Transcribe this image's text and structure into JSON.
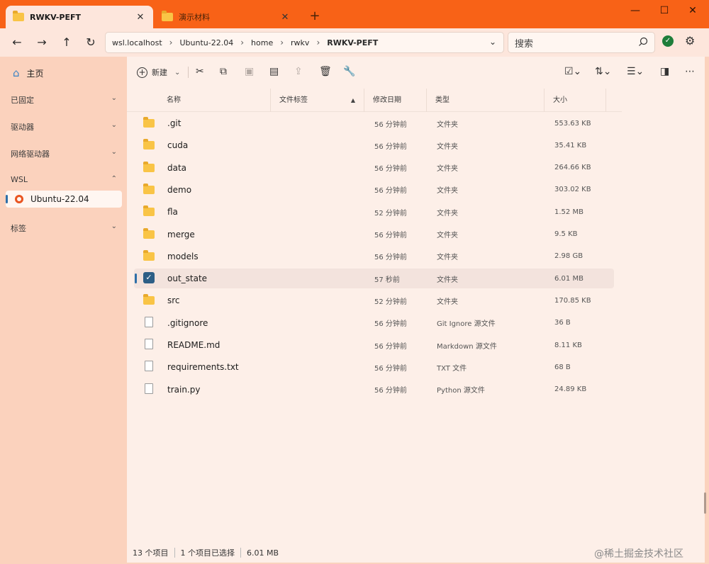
{
  "tabs": [
    {
      "label": "RWKV-PEFT",
      "close": "✕"
    },
    {
      "label": "演示材料",
      "close": "✕"
    }
  ],
  "new_tab": "+",
  "window_controls": {
    "minimize": "—",
    "maximize": "☐",
    "close": "✕"
  },
  "nav": {
    "back": "←",
    "forward": "→",
    "up": "↑",
    "refresh": "↻"
  },
  "breadcrumb": [
    "wsl.localhost",
    "Ubuntu-22.04",
    "home",
    "rwkv",
    "RWKV-PEFT"
  ],
  "breadcrumb_sep": "›",
  "search": {
    "placeholder": "搜索"
  },
  "sidebar": {
    "home": "主页",
    "sections": [
      {
        "label": "已固定",
        "chevron": "⌄"
      },
      {
        "label": "驱动器",
        "chevron": "⌄"
      },
      {
        "label": "网络驱动器",
        "chevron": "⌄"
      },
      {
        "label": "WSL",
        "chevron": "⌃"
      },
      {
        "label": "标签",
        "chevron": "⌄"
      }
    ],
    "selected_item": "Ubuntu-22.04"
  },
  "toolbar": {
    "new_label": "新建",
    "more": "⋯"
  },
  "columns": [
    "名称",
    "文件标签",
    "修改日期",
    "类型",
    "大小"
  ],
  "sort_indicator": "▲",
  "files": [
    {
      "name": ".git",
      "date": "56 分钟前",
      "type": "文件夹",
      "size": "553.63 KB",
      "kind": "folder"
    },
    {
      "name": "cuda",
      "date": "56 分钟前",
      "type": "文件夹",
      "size": "35.41 KB",
      "kind": "folder"
    },
    {
      "name": "data",
      "date": "56 分钟前",
      "type": "文件夹",
      "size": "264.66 KB",
      "kind": "folder"
    },
    {
      "name": "demo",
      "date": "56 分钟前",
      "type": "文件夹",
      "size": "303.02 KB",
      "kind": "folder"
    },
    {
      "name": "fla",
      "date": "52 分钟前",
      "type": "文件夹",
      "size": "1.52 MB",
      "kind": "folder"
    },
    {
      "name": "merge",
      "date": "56 分钟前",
      "type": "文件夹",
      "size": "9.5 KB",
      "kind": "folder"
    },
    {
      "name": "models",
      "date": "56 分钟前",
      "type": "文件夹",
      "size": "2.98 GB",
      "kind": "folder"
    },
    {
      "name": "out_state",
      "date": "57 秒前",
      "type": "文件夹",
      "size": "6.01 MB",
      "kind": "selected"
    },
    {
      "name": "src",
      "date": "52 分钟前",
      "type": "文件夹",
      "size": "170.85 KB",
      "kind": "folder"
    },
    {
      "name": ".gitignore",
      "date": "56 分钟前",
      "type": "Git Ignore 源文件",
      "size": "36 B",
      "kind": "file"
    },
    {
      "name": "README.md",
      "date": "56 分钟前",
      "type": "Markdown 源文件",
      "size": "8.11 KB",
      "kind": "file"
    },
    {
      "name": "requirements.txt",
      "date": "56 分钟前",
      "type": "TXT 文件",
      "size": "68 B",
      "kind": "file"
    },
    {
      "name": "train.py",
      "date": "56 分钟前",
      "type": "Python 源文件",
      "size": "24.89 KB",
      "kind": "file"
    }
  ],
  "status": {
    "count": "13 个项目",
    "selected": "1 个项目已选择",
    "size": "6.01 MB"
  },
  "watermark": "@稀土掘金技术社区"
}
